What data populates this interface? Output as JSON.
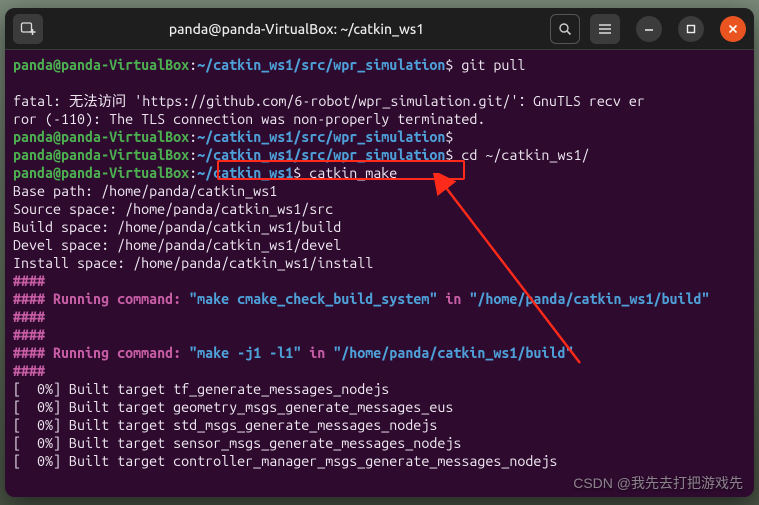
{
  "titlebar": {
    "title": "panda@panda-VirtualBox: ~/catkin_ws1"
  },
  "prompt": {
    "user_host": "panda@panda-VirtualBox",
    "path_wpr": "~/catkin_ws1/src/wpr_simulation",
    "path_ws1": "~/catkin_ws1"
  },
  "cmds": {
    "git_pull": "git pull",
    "cd_ws1": "cd ~/catkin_ws1/",
    "catkin_make": "catkin_make"
  },
  "error": {
    "line1": "fatal: 无法访问 'https://github.com/6-robot/wpr_simulation.git/'：GnuTLS recv er",
    "line2": "ror (-110): The TLS connection was non-properly terminated."
  },
  "spaces": {
    "base": "Base path: /home/panda/catkin_ws1",
    "source": "Source space: /home/panda/catkin_ws1/src",
    "build": "Build space: /home/panda/catkin_ws1/build",
    "devel": "Devel space: /home/panda/catkin_ws1/devel",
    "install": "Install space: /home/panda/catkin_ws1/install"
  },
  "hashes": "####",
  "running_label": "#### Running command: ",
  "in_label": " in ",
  "quoted": {
    "cmake_check": "\"make cmake_check_build_system\"",
    "build_dir_wrap": "\"/home/panda/catkin_ws1/build\"",
    "make_j1": "\"make -j1 -l1\"",
    "build_dir": "\"/home/panda/catkin_ws1/build\""
  },
  "targets": {
    "t1": "[  0%] Built target tf_generate_messages_nodejs",
    "t2": "[  0%] Built target geometry_msgs_generate_messages_eus",
    "t3": "[  0%] Built target std_msgs_generate_messages_nodejs",
    "t4": "[  0%] Built target sensor_msgs_generate_messages_nodejs",
    "t5": "[  0%] Built target controller_manager_msgs_generate_messages_nodejs"
  },
  "watermark": "CSDN @我先去打把游戏先"
}
